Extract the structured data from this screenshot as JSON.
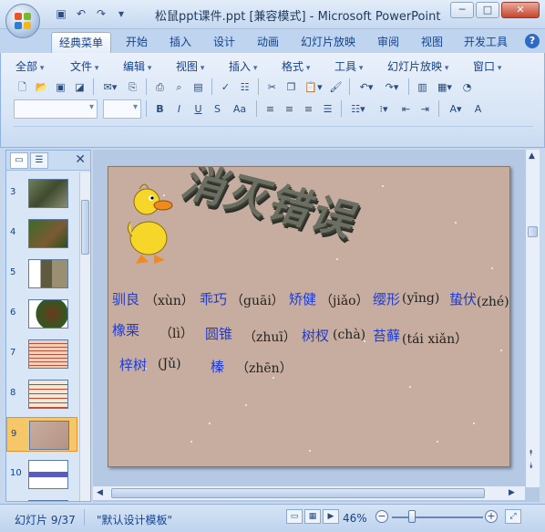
{
  "window": {
    "title": "松鼠ppt课件.ppt [兼容模式] - Microsoft PowerPoint",
    "minimize": "─",
    "maximize": "□",
    "close": "✕"
  },
  "qat": {
    "save_icon": "save-icon",
    "undo": "↶",
    "redo": "↷",
    "more": "▾"
  },
  "tabs": [
    {
      "label": "经典菜单",
      "active": true
    },
    {
      "label": "开始"
    },
    {
      "label": "插入"
    },
    {
      "label": "设计"
    },
    {
      "label": "动画"
    },
    {
      "label": "幻灯片放映"
    },
    {
      "label": "审阅"
    },
    {
      "label": "视图"
    },
    {
      "label": "开发工具"
    }
  ],
  "menus": [
    "全部",
    "文件",
    "编辑",
    "视图",
    "插入",
    "格式",
    "工具",
    "幻灯片放映",
    "窗口"
  ],
  "format_buttons": {
    "bold": "B",
    "italic": "I",
    "underline": "U",
    "strike": "S",
    "case": "Aa"
  },
  "thumbnails": [
    {
      "num": "3"
    },
    {
      "num": "4"
    },
    {
      "num": "5"
    },
    {
      "num": "6"
    },
    {
      "num": "7"
    },
    {
      "num": "8"
    },
    {
      "num": "9",
      "selected": true
    },
    {
      "num": "10"
    }
  ],
  "slide": {
    "title": "消灭错误",
    "rows": [
      [
        {
          "w": "驯良",
          "p": "（xùn）"
        },
        {
          "w": "乖巧",
          "p": "（guāi）"
        },
        {
          "w": "矫健",
          "p": "（jiǎo）"
        },
        {
          "w": "缨形",
          "p": "(yīng)"
        },
        {
          "w": "蛰伏",
          "p": "(zhé)"
        }
      ],
      [
        {
          "w": "橡栗",
          "p": "（lì）"
        },
        {
          "w": "圆锥",
          "p": "（zhuī）"
        },
        {
          "w": "树杈",
          "p": "(chà)"
        },
        {
          "w": "苔藓",
          "p": "(tái xiǎn）"
        }
      ],
      [
        {
          "w": "梓树",
          "p": "(Jǔ)"
        },
        {
          "w": "榛",
          "p": "（zhēn）"
        }
      ]
    ]
  },
  "status": {
    "slide_info": "幻灯片 9/37",
    "template": "\"默认设计模板\"",
    "zoom": "46%"
  }
}
